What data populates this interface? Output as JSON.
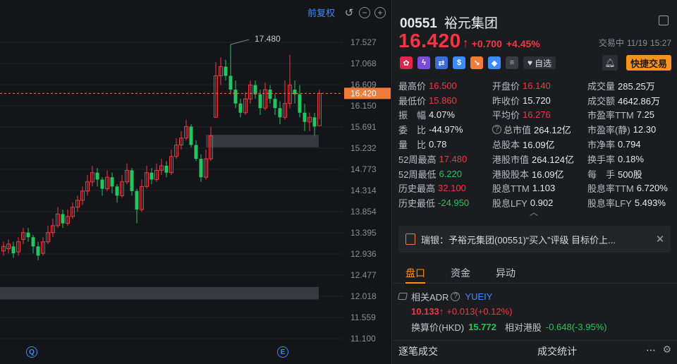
{
  "chart": {
    "adjust_label": "前复权",
    "high_annotation": "17.480",
    "last_price_label": "16.420",
    "y_ticks": [
      "17.527",
      "17.068",
      "16.609",
      "16.150",
      "15.691",
      "15.232",
      "14.773",
      "14.314",
      "13.854",
      "13.395",
      "12.936",
      "12.477",
      "12.018",
      "11.559",
      "11.100"
    ],
    "marker_q": "Q",
    "marker_e": "E"
  },
  "chart_data": {
    "type": "candlestick",
    "ylim": [
      11.1,
      17.527
    ],
    "candles": [
      [
        13.0,
        13.1,
        12.9,
        13.2
      ],
      [
        13.05,
        13.15,
        12.95,
        13.25
      ],
      [
        13.1,
        12.95,
        12.85,
        13.2
      ],
      [
        12.98,
        13.2,
        12.9,
        13.3
      ],
      [
        13.25,
        13.4,
        13.15,
        13.5
      ],
      [
        13.4,
        13.3,
        13.2,
        13.5
      ],
      [
        13.3,
        13.1,
        12.95,
        13.35
      ],
      [
        13.1,
        12.9,
        12.8,
        13.2
      ],
      [
        12.95,
        13.2,
        12.9,
        13.3
      ],
      [
        13.2,
        13.4,
        13.15,
        13.55
      ],
      [
        13.4,
        13.55,
        13.3,
        13.7
      ],
      [
        13.55,
        13.8,
        13.5,
        13.95
      ],
      [
        13.8,
        13.6,
        13.5,
        13.9
      ],
      [
        13.6,
        13.75,
        13.55,
        13.9
      ],
      [
        13.75,
        13.95,
        13.7,
        14.05
      ],
      [
        13.95,
        14.1,
        13.85,
        14.2
      ],
      [
        14.1,
        14.3,
        14.0,
        14.4
      ],
      [
        14.3,
        14.5,
        14.2,
        14.65
      ],
      [
        14.5,
        14.7,
        14.4,
        14.85
      ],
      [
        14.7,
        14.55,
        14.4,
        14.8
      ],
      [
        14.55,
        14.35,
        14.2,
        14.6
      ],
      [
        14.35,
        14.6,
        14.3,
        14.75
      ],
      [
        14.6,
        14.4,
        14.25,
        14.7
      ],
      [
        14.4,
        14.2,
        14.05,
        14.45
      ],
      [
        14.2,
        14.5,
        14.15,
        14.65
      ],
      [
        14.5,
        14.75,
        14.45,
        14.9
      ],
      [
        14.75,
        14.3,
        14.2,
        14.8
      ],
      [
        14.3,
        13.9,
        13.6,
        14.35
      ],
      [
        13.9,
        14.4,
        13.85,
        14.55
      ],
      [
        14.4,
        14.7,
        14.35,
        14.85
      ],
      [
        14.7,
        14.55,
        14.45,
        14.8
      ],
      [
        14.55,
        14.75,
        14.5,
        14.9
      ],
      [
        14.75,
        14.85,
        14.65,
        15.0
      ],
      [
        14.85,
        14.7,
        14.6,
        14.95
      ],
      [
        14.7,
        15.05,
        14.65,
        15.2
      ],
      [
        15.05,
        15.3,
        15.0,
        15.45
      ],
      [
        15.3,
        15.45,
        15.2,
        15.6
      ],
      [
        15.45,
        15.7,
        15.4,
        15.85
      ],
      [
        15.7,
        15.3,
        15.25,
        15.75
      ],
      [
        15.3,
        15.0,
        14.95,
        15.4
      ],
      [
        15.0,
        14.6,
        14.5,
        15.1
      ],
      [
        14.6,
        15.0,
        14.55,
        15.2
      ],
      [
        15.0,
        15.5,
        14.95,
        15.7
      ],
      [
        15.9,
        16.8,
        15.9,
        17.1
      ],
      [
        16.8,
        17.0,
        16.6,
        17.2
      ],
      [
        17.0,
        16.8,
        16.7,
        17.15
      ],
      [
        16.8,
        16.5,
        16.4,
        17.48
      ],
      [
        16.5,
        16.2,
        16.1,
        16.7
      ],
      [
        16.2,
        16.0,
        15.9,
        16.3
      ],
      [
        16.0,
        16.3,
        15.95,
        16.45
      ],
      [
        16.3,
        16.6,
        16.2,
        16.7
      ],
      [
        16.6,
        16.4,
        16.3,
        16.7
      ],
      [
        16.4,
        16.1,
        15.95,
        16.5
      ],
      [
        16.1,
        16.5,
        16.05,
        16.65
      ],
      [
        16.5,
        16.3,
        16.2,
        16.6
      ],
      [
        16.3,
        16.1,
        15.95,
        16.4
      ],
      [
        16.1,
        15.9,
        15.75,
        16.25
      ],
      [
        15.9,
        16.2,
        15.85,
        16.7
      ],
      [
        16.2,
        16.6,
        16.1,
        17.25
      ],
      [
        16.5,
        16.4,
        16.2,
        16.7
      ],
      [
        16.4,
        16.0,
        15.9,
        16.6
      ],
      [
        16.0,
        15.8,
        15.6,
        16.2
      ],
      [
        15.8,
        15.9,
        15.6,
        16.0
      ],
      [
        15.9,
        15.7,
        15.5,
        16.0
      ],
      [
        15.72,
        16.42,
        15.86,
        16.5
      ]
    ],
    "zones": [
      [
        15.25,
        15.52,
        41
      ],
      [
        11.95,
        12.22,
        0
      ]
    ]
  },
  "stock": {
    "code": "00551",
    "name": "裕元集团",
    "price": "16.420",
    "arrow": "↑",
    "change": "+0.700",
    "change_pct": "+4.45%",
    "status": "交易中",
    "date": "11/19",
    "time": "15:27",
    "watch_label": "自选",
    "quick_trade": "快捷交易"
  },
  "stats": [
    [
      {
        "l": "最高价",
        "v": "16.500",
        "c": "red"
      },
      {
        "l": "开盘价",
        "v": "16.140",
        "c": "red"
      },
      {
        "l": "成交量",
        "v": "285.25万",
        "c": ""
      }
    ],
    [
      {
        "l": "最低价",
        "v": "15.860",
        "c": "red"
      },
      {
        "l": "昨收价",
        "v": "15.720",
        "c": ""
      },
      {
        "l": "成交额",
        "v": "4642.86万",
        "c": ""
      }
    ],
    [
      {
        "l": "振　幅",
        "v": "4.07%",
        "c": ""
      },
      {
        "l": "平均价",
        "v": "16.276",
        "c": "red"
      },
      {
        "l": "市盈率TTM",
        "v": "7.25",
        "c": ""
      }
    ],
    [
      {
        "l": "委　比",
        "v": "-44.97%",
        "c": ""
      },
      {
        "l": "总市值",
        "v": "264.12亿",
        "c": "",
        "q": true
      },
      {
        "l": "市盈率(静)",
        "v": "12.30",
        "c": ""
      }
    ],
    [
      {
        "l": "量　比",
        "v": "0.78",
        "c": ""
      },
      {
        "l": "总股本",
        "v": "16.09亿",
        "c": ""
      },
      {
        "l": "市净率",
        "v": "0.794",
        "c": ""
      }
    ],
    [
      {
        "l": "52周最高",
        "v": "17.480",
        "c": "red"
      },
      {
        "l": "港股市值",
        "v": "264.124亿",
        "c": ""
      },
      {
        "l": "换手率",
        "v": "0.18%",
        "c": ""
      }
    ],
    [
      {
        "l": "52周最低",
        "v": "6.220",
        "c": "green"
      },
      {
        "l": "港股股本",
        "v": "16.09亿",
        "c": ""
      },
      {
        "l": "每　手",
        "v": "500股",
        "c": ""
      }
    ],
    [
      {
        "l": "历史最高",
        "v": "32.100",
        "c": "red"
      },
      {
        "l": "股息TTM",
        "v": "1.103",
        "c": ""
      },
      {
        "l": "股息率TTM",
        "v": "6.720%",
        "c": ""
      }
    ],
    [
      {
        "l": "历史最低",
        "v": "-24.950",
        "c": "green"
      },
      {
        "l": "股息LFY",
        "v": "0.902",
        "c": ""
      },
      {
        "l": "股息率LFY",
        "v": "5.493%",
        "c": ""
      }
    ]
  ],
  "news": {
    "text": "瑞银：予裕元集团(00551)“买入”评级 目标价上..."
  },
  "tabs": [
    "盘口",
    "资金",
    "异动"
  ],
  "adr": {
    "label": "相关ADR",
    "symbol": "YUEIY",
    "price": "10.133↑",
    "change": "+0.013(+0.12%)",
    "conv_label": "换算价(HKD)",
    "conv_value": "15.772",
    "rel_label": "相对港股",
    "rel_value": "-0.648(-3.95%)"
  },
  "bottom": {
    "left": "逐笔成交",
    "right": "成交统计"
  },
  "colors": {
    "up": "#f23645",
    "down": "#22c55e",
    "accent": "#f7931a",
    "link": "#3d8bfd"
  }
}
